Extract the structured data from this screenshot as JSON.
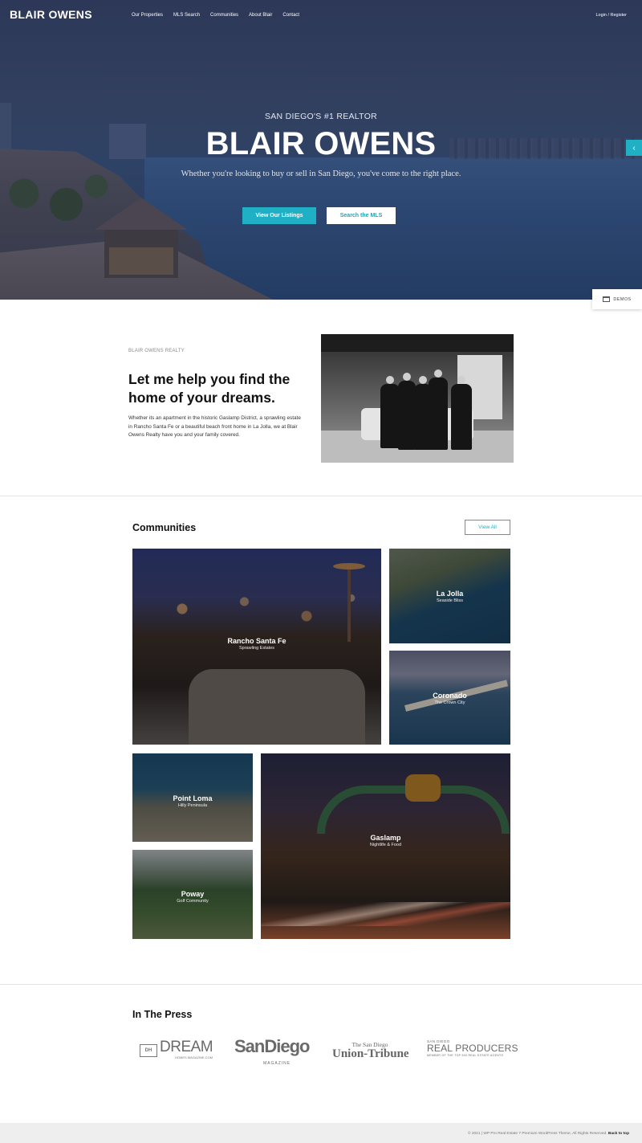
{
  "header": {
    "logo": "BLAIR OWENS",
    "nav": [
      "Our Properties",
      "MLS Search",
      "Communities",
      "About Blair",
      "Contact"
    ],
    "login": "Login / Register"
  },
  "hero": {
    "kicker": "SAN DIEGO'S #1 REALTOR",
    "title": "BLAIR OWENS",
    "subtitle": "Whether you're looking to buy or sell in San Diego, you've come to the right place.",
    "primary_button": "View Our Listings",
    "secondary_button": "Search the MLS",
    "toggle_icon": "‹"
  },
  "demos": {
    "label": "DEMOS",
    "icon": "calendar-icon"
  },
  "about": {
    "kicker": "BLAIR OWENS REALTY",
    "title": "Let me help you find the home of your dreams.",
    "text": "Whether its an apartment in the historic Gaslamp District, a sprawling estate in Rancho Santa Fe or a beautiful beach front home in La Jolla, we at Blair Owens Realty have you and your family covered."
  },
  "communities": {
    "title": "Communities",
    "view_all": "View All",
    "items": [
      {
        "name": "Rancho Santa Fe",
        "tagline": "Sprawling Estates"
      },
      {
        "name": "La Jolla",
        "tagline": "Seaside Bliss"
      },
      {
        "name": "Coronado",
        "tagline": "The Crown City"
      },
      {
        "name": "Point Loma",
        "tagline": "Hilly Peninsula"
      },
      {
        "name": "Gaslamp",
        "tagline": "Nightlife & Food"
      },
      {
        "name": "Poway",
        "tagline": "Golf Community"
      }
    ]
  },
  "press": {
    "title": "In The Press",
    "dream": {
      "mark": "DH",
      "word": "DREAM",
      "small": "HOMES MAGAZINE.COM"
    },
    "sandiego": {
      "word": "SanDiego",
      "sub": "MAGAZINE"
    },
    "ut": {
      "top": "The San Diego",
      "bottom": "Union-Tribune"
    },
    "rp": {
      "top": "SAN DIEGO",
      "mid": "REAL PRODUCERS",
      "bot": "MEMBER OF THE TOP 500 REAL ESTATE AGENTS"
    }
  },
  "footer": {
    "copyright": "© 2021 | WP Pro Real Estate 7 Premium WordPress Theme, All Rights Reserved.",
    "back_to_top": "Back to top"
  }
}
